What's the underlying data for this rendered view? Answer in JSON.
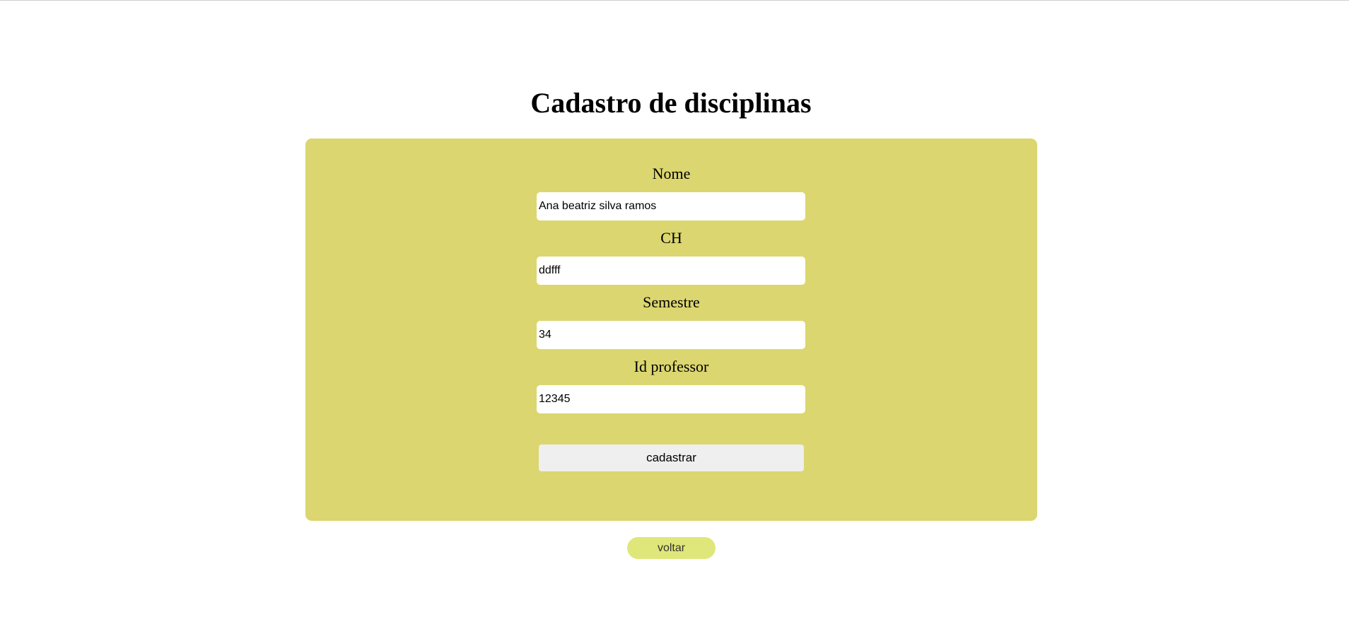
{
  "page": {
    "title": "Cadastro de disciplinas"
  },
  "form": {
    "fields": [
      {
        "label": "Nome",
        "value": "Ana beatriz silva ramos"
      },
      {
        "label": "CH",
        "value": "ddfff"
      },
      {
        "label": "Semestre",
        "value": "34"
      },
      {
        "label": "Id professor",
        "value": "12345"
      }
    ],
    "submit_label": "cadastrar"
  },
  "nav": {
    "back_label": "voltar"
  },
  "colors": {
    "panel_background": "#dbd66f",
    "back_button_background": "#dfe77a",
    "submit_button_background": "#efefef"
  }
}
